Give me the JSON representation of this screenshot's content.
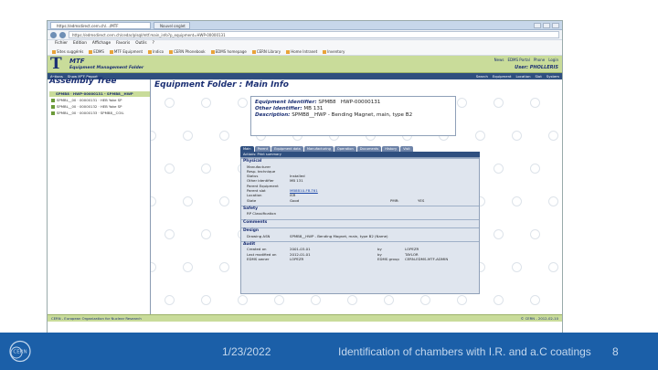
{
  "browser": {
    "tab_title": "https://edmsdirect.cern.ch/.../MTF",
    "tab2_title": "Nouvel onglet",
    "url": "https://edmsdirect.cern.ch/cedar/plsql/mtf.main_info?p_equipment=HWP-00000131",
    "menu": [
      "Fichier",
      "Edition",
      "Affichage",
      "Favoris",
      "Outils",
      "?"
    ],
    "bookmarks": [
      "Sites suggérés",
      "EDMS",
      "MTF Equipment",
      "Indico",
      "CERN Phonebook",
      "EDMS homepage",
      "CERN Library",
      "Home Intranet",
      "Inventory"
    ]
  },
  "app": {
    "logo": "T",
    "title": "MTF",
    "subtitle": "Equipment Management Folder",
    "top_links": [
      "News",
      "EDMS Portal",
      "Phone",
      "Login"
    ],
    "user": "User: PHOLLERIS",
    "actionbar_left": [
      "Actions",
      "Show MTF Report"
    ],
    "actionbar_right": [
      "Search",
      "Equipment",
      "Location",
      "Slot",
      "System"
    ]
  },
  "tree": {
    "title": "Assembly Tree",
    "header": "SPMB8 · HWP-00000131 - SPMB8__HWP",
    "items": [
      "SPMBL__00 · 00000131 · HEB Yoke SP",
      "SPMBL__00 · 00000132 · HEB Yoke SP",
      "SPMBL__00 · 00000133 · SPMB8__COIL"
    ]
  },
  "main": {
    "title": "Equipment Folder : Main Info",
    "identifier_label": "Equipment Identifier:",
    "identifier_value": "SPMB8",
    "identifier_hwp": "HWP-00000131",
    "other_label": "Other Identifier:",
    "other_value": "MB 131",
    "desc_label": "Description:",
    "desc_value": "SPMB8__HWP - Bending Magnet, main, type B2",
    "tabs": [
      "Main",
      "Parent",
      "Equipment data",
      "Manufacturing",
      "Operation",
      "Documents",
      "History",
      "Visit"
    ],
    "actions_text": "Actions: Print summary",
    "sections": {
      "physical": "Physical",
      "safety": "Safety",
      "comments": "Comments",
      "design": "Design",
      "audit": "Audit"
    },
    "physical_rows": [
      {
        "k": "Manufacturer",
        "v": ""
      },
      {
        "k": "Resp. technique",
        "v": ""
      },
      {
        "k": "Status",
        "v": "Installed"
      },
      {
        "k": "Other identifier",
        "v": "MB 131"
      },
      {
        "k": "Parent Equipment",
        "v": ""
      },
      {
        "k": "Parent slot",
        "v": "MB8B10-FB-T61"
      },
      {
        "k": "Location",
        "v": "ISR"
      },
      {
        "k": "State",
        "v": "Good",
        "k2": "PMR:",
        "v2": "YES"
      }
    ],
    "safety_row": "RP Classification",
    "design_row": {
      "k": "Drawing ASN",
      "v": "SPMB8__HWP - Bending Magnet, main, type B2 (Name)"
    },
    "audit_rows": [
      {
        "k": "Created on",
        "v": "2001-03-01",
        "k2": "by",
        "v2": "LOPEZR"
      },
      {
        "k": "Last modified on",
        "v": "2012-01-01",
        "k2": "by",
        "v2": "TAYLOR"
      },
      {
        "k": "EDMS owner",
        "v": "LOPEZR",
        "k2": "EDMS group",
        "v2": "CERN-EDMS-MTF-ADMIN"
      }
    ],
    "footer_left": "CERN - European Organization for Nuclear Research",
    "footer_right": "© CERN - 2012-02-10"
  },
  "slide": {
    "date": "1/23/2022",
    "title": "Identification of chambers with I.R. and a.C coatings",
    "page": "8",
    "logo_text": "CERN"
  },
  "colors": {
    "slide_bar": "#1b5fa8",
    "app_header": "#c9dc9a",
    "navy": "#1b2f73"
  }
}
